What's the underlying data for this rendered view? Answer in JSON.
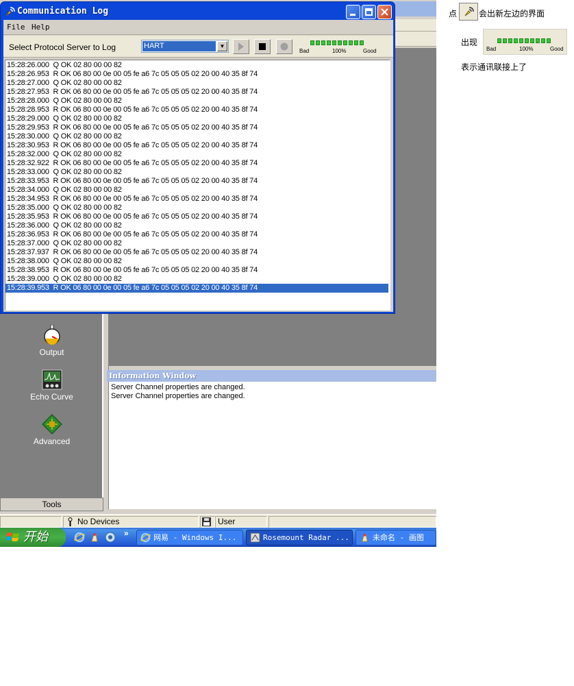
{
  "dialog": {
    "title": "Communication Log",
    "menu": [
      "File",
      "Help"
    ],
    "toolbar": {
      "select_label": "Select Protocol Server to Log",
      "protocol_value": "HART",
      "quality_bad": "Bad",
      "quality_mid": "100%",
      "quality_good": "Good"
    },
    "log": [
      "15:28:26.000  Q OK 02 80 00 00 82",
      "15:28:26.953  R OK 06 80 00 0e 00 05 fe a6 7c 05 05 05 02 20 00 40 35 8f 74",
      "15:28:27.000  Q OK 02 80 00 00 82",
      "15:28:27.953  R OK 06 80 00 0e 00 05 fe a6 7c 05 05 05 02 20 00 40 35 8f 74",
      "15:28:28.000  Q OK 02 80 00 00 82",
      "15:28:28.953  R OK 06 80 00 0e 00 05 fe a6 7c 05 05 05 02 20 00 40 35 8f 74",
      "15:28:29.000  Q OK 02 80 00 00 82",
      "15:28:29.953  R OK 06 80 00 0e 00 05 fe a6 7c 05 05 05 02 20 00 40 35 8f 74",
      "15:28:30.000  Q OK 02 80 00 00 82",
      "15:28:30.953  R OK 06 80 00 0e 00 05 fe a6 7c 05 05 05 02 20 00 40 35 8f 74",
      "15:28:32.000  Q OK 02 80 00 00 82",
      "15:28:32.922  R OK 06 80 00 0e 00 05 fe a6 7c 05 05 05 02 20 00 40 35 8f 74",
      "15:28:33.000  Q OK 02 80 00 00 82",
      "15:28:33.953  R OK 06 80 00 0e 00 05 fe a6 7c 05 05 05 02 20 00 40 35 8f 74",
      "15:28:34.000  Q OK 02 80 00 00 82",
      "15:28:34.953  R OK 06 80 00 0e 00 05 fe a6 7c 05 05 05 02 20 00 40 35 8f 74",
      "15:28:35.000  Q OK 02 80 00 00 82",
      "15:28:35.953  R OK 06 80 00 0e 00 05 fe a6 7c 05 05 05 02 20 00 40 35 8f 74",
      "15:28:36.000  Q OK 02 80 00 00 82",
      "15:28:36.953  R OK 06 80 00 0e 00 05 fe a6 7c 05 05 05 02 20 00 40 35 8f 74",
      "15:28:37.000  Q OK 02 80 00 00 82",
      "15:28:37.937  R OK 06 80 00 0e 00 05 fe a6 7c 05 05 05 02 20 00 40 35 8f 74",
      "15:28:38.000  Q OK 02 80 00 00 82",
      "15:28:38.953  R OK 06 80 00 0e 00 05 fe a6 7c 05 05 05 02 20 00 40 35 8f 74",
      "15:28:39.000  Q OK 02 80 00 00 82",
      "15:28:39.953  R OK 06 80 00 0e 00 05 fe a6 7c 05 05 05 02 20 00 40 35 8f 74"
    ]
  },
  "tools": {
    "items": [
      "Output",
      "Echo Curve",
      "Advanced"
    ],
    "tab_label": "Tools"
  },
  "info_window": {
    "title": "Information Window",
    "lines": [
      "Server Channel properties are changed.",
      "Server Channel properties are changed."
    ]
  },
  "status_bar": {
    "devices": "No Devices",
    "user": "User"
  },
  "taskbar": {
    "start": "开始",
    "tasks": [
      "网易 - Windows I...",
      "Rosemount Radar ...",
      "未命名 - 画图"
    ],
    "overflow": "»"
  },
  "annotation": {
    "line1_pre": "点",
    "line1_post": "会出新左边的界面",
    "line2": "出现",
    "line3": "表示通讯联接上了",
    "bar_bad": "Bad",
    "bar_mid": "100%",
    "bar_good": "Good"
  },
  "colors": {
    "titlebar": "#0b46d8",
    "selection": "#316ac5",
    "quality_green": "#3cc33c"
  }
}
